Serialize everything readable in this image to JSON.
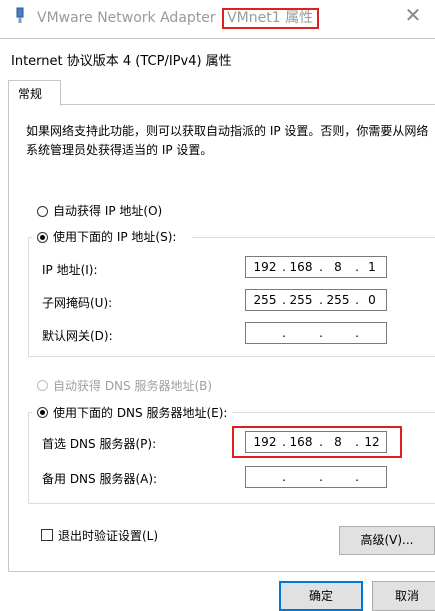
{
  "outer_window": {
    "title_prefix": "VMware Network Adapter ",
    "title_highlight": "VMnet1 属性",
    "close_glyph": "✕"
  },
  "dialog": {
    "title": "Internet 协议版本 4 (TCP/IPv4) 属性",
    "tab_label": "常规",
    "description": "如果网络支持此功能，则可以获取自动指派的 IP 设置。否则，你需要从网络系统管理员处获得适当的 IP 设置。",
    "ip_section": {
      "auto_label": "自动获得 IP 地址(O)",
      "manual_label": "使用下面的 IP 地址(S):",
      "ip_label": "IP 地址(I):",
      "ip_value": [
        "192",
        "168",
        "8",
        "1"
      ],
      "mask_label": "子网掩码(U):",
      "mask_value": [
        "255",
        "255",
        "255",
        "0"
      ],
      "gateway_label": "默认网关(D):",
      "gateway_value": [
        "",
        "",
        "",
        ""
      ]
    },
    "dns_section": {
      "auto_label": "自动获得 DNS 服务器地址(B)",
      "manual_label": "使用下面的 DNS 服务器地址(E):",
      "preferred_label": "首选 DNS 服务器(P):",
      "preferred_value": [
        "192",
        "168",
        "8",
        "12"
      ],
      "alternate_label": "备用 DNS 服务器(A):",
      "alternate_value": [
        "",
        "",
        "",
        ""
      ]
    },
    "validate_label": "退出时验证设置(L)",
    "advanced_label": "高级(V)...",
    "ok_label": "确定",
    "cancel_label": "取消"
  },
  "colors": {
    "highlight_border": "#e02020",
    "default_button_border": "#0078d7"
  }
}
